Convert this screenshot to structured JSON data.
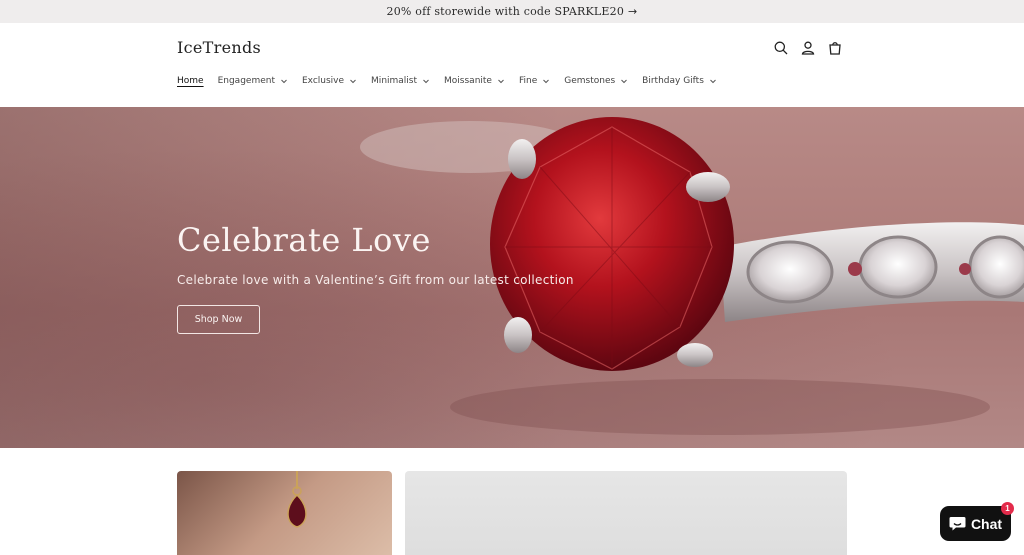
{
  "announcement": {
    "text": "20% off storewide with code SPARKLE20",
    "arrow": "→"
  },
  "header": {
    "logo": "IceTrends",
    "icons": [
      "search-icon",
      "account-icon",
      "cart-icon"
    ]
  },
  "nav": {
    "items": [
      {
        "label": "Home",
        "active": true,
        "dropdown": false
      },
      {
        "label": "Engagement",
        "active": false,
        "dropdown": true
      },
      {
        "label": "Exclusive",
        "active": false,
        "dropdown": true
      },
      {
        "label": "Minimalist",
        "active": false,
        "dropdown": true
      },
      {
        "label": "Moissanite",
        "active": false,
        "dropdown": true
      },
      {
        "label": "Fine",
        "active": false,
        "dropdown": true
      },
      {
        "label": "Gemstones",
        "active": false,
        "dropdown": true
      },
      {
        "label": "Birthday Gifts",
        "active": false,
        "dropdown": true
      }
    ]
  },
  "hero": {
    "title": "Celebrate Love",
    "subtitle": "Celebrate love with a Valentine’s Gift from our latest collection",
    "button_label": "Shop Now"
  },
  "chat": {
    "label": "Chat",
    "badge": "1"
  },
  "colors": {
    "announcement_bg": "#efeded",
    "hero_bg": "#b07f7c",
    "ruby": "#b3121d",
    "chat_bg": "#111111",
    "badge": "#e32b4b"
  }
}
